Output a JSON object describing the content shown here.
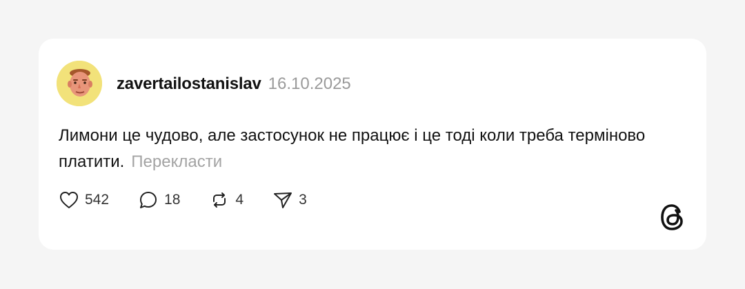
{
  "post": {
    "username": "zavertailostanislav",
    "date": "16.10.2025",
    "text": "Лимони це чудово, але застосунок не працює і це тоді коли треба терміново платити.",
    "translate_label": "Перекласти"
  },
  "actions": {
    "likes": "542",
    "replies": "18",
    "reposts": "4",
    "shares": "3"
  },
  "icons": {
    "like": "heart-icon",
    "reply": "speech-bubble-icon",
    "repost": "repost-icon",
    "share": "paper-plane-icon",
    "brand": "threads-logo-icon"
  },
  "colors": {
    "background": "#f5f5f5",
    "card": "#ffffff",
    "text": "#111111",
    "muted": "#9a9a9a",
    "avatar_bg": "#f2e27a"
  }
}
